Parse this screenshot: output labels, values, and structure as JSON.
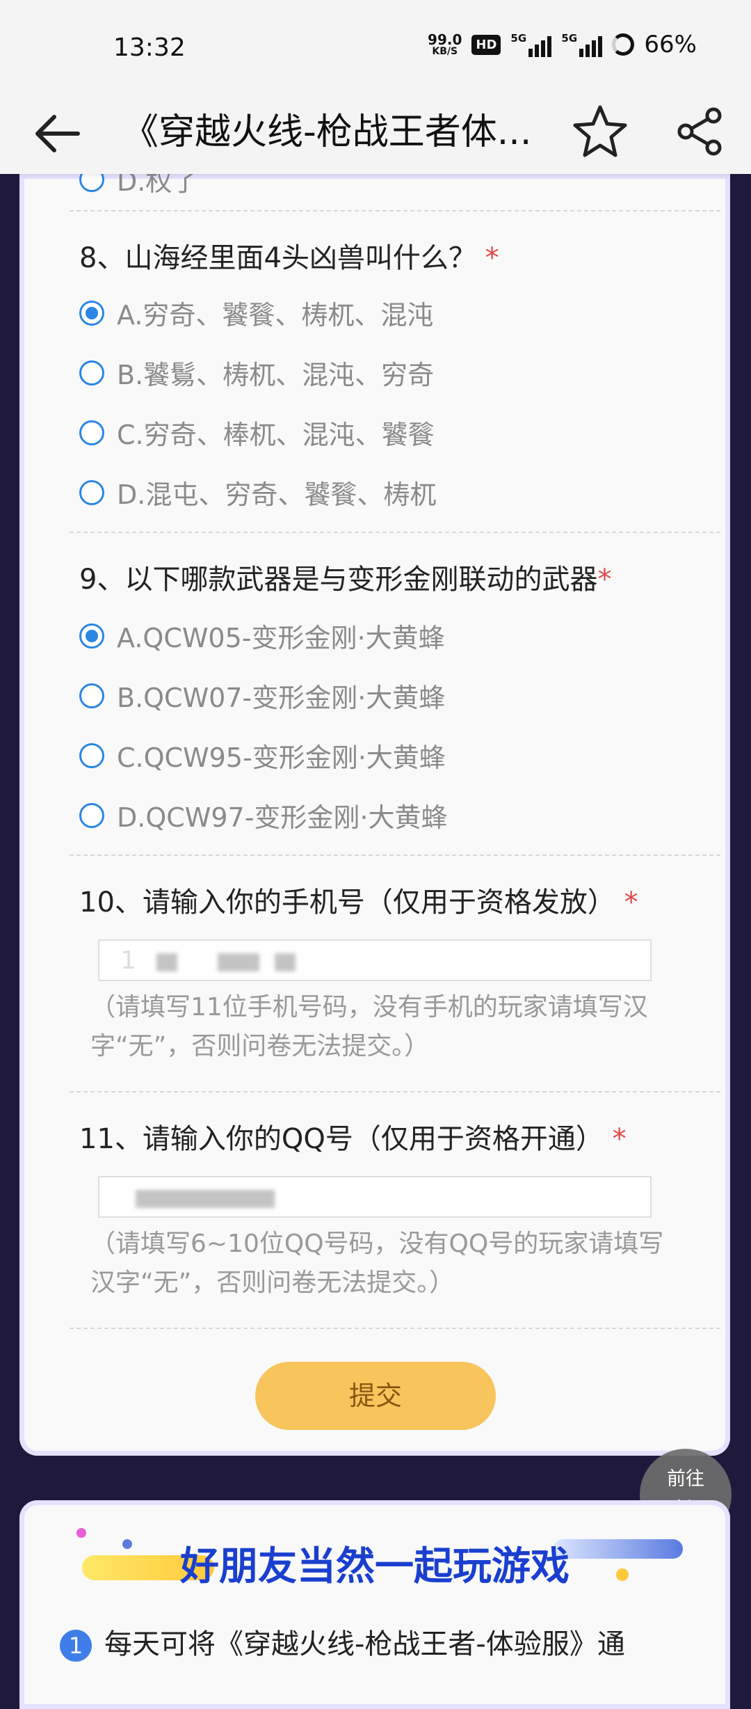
{
  "status_bar": {
    "time": "13:32",
    "net_speed_value": "99.0",
    "net_speed_unit": "KB/S",
    "hd_badge": "HD",
    "signal1_label": "5G",
    "signal2_label": "5G",
    "battery": "66%"
  },
  "app_bar": {
    "title": "《穿越火线-枪战王者体...",
    "back_icon": "arrow-left-icon",
    "star_icon": "star-icon",
    "share_icon": "share-icon"
  },
  "survey": {
    "prev_option_partial": "D.权了",
    "questions": [
      {
        "title": "8、山海经里面4头凶兽叫什么？",
        "required": "*",
        "options": [
          {
            "label": "A.穷奇、饕餮、梼杌、混沌",
            "checked": true
          },
          {
            "label": "B.饕鬄、梼杌、混沌、穷奇",
            "checked": false
          },
          {
            "label": "C.穷奇、棒杌、混沌、饕餮",
            "checked": false
          },
          {
            "label": "D.混屯、穷奇、饕餮、梼杌",
            "checked": false
          }
        ]
      },
      {
        "title": "9、以下哪款武器是与变形金刚联动的武器",
        "required": "*",
        "options": [
          {
            "label": "A.QCW05-变形金刚·大黄蜂",
            "checked": true
          },
          {
            "label": "B.QCW07-变形金刚·大黄蜂",
            "checked": false
          },
          {
            "label": "C.QCW95-变形金刚·大黄蜂",
            "checked": false
          },
          {
            "label": "D.QCW97-变形金刚·大黄蜂",
            "checked": false
          }
        ]
      }
    ],
    "phone": {
      "title": "10、请输入你的手机号（仅用于资格发放）",
      "required": "*",
      "value_visible": "1",
      "hint": "（请填写11位手机号码，没有手机的玩家请填写汉字“无”，否则问卷无法提交。）"
    },
    "qq": {
      "title": "11、请输入你的QQ号（仅用于资格开通）",
      "required": "*",
      "hint": "（请填写6~10位QQ号码，没有QQ号的玩家请填写汉字“无”，否则问卷无法提交。）"
    },
    "submit_label": "提交"
  },
  "forum_button": {
    "line1": "前往",
    "line2": "论坛"
  },
  "promo": {
    "title": "好朋友当然一起玩游戏",
    "item_number": "1",
    "item_text": "每天可将《穿越火线-枪战王者-体验服》通"
  },
  "colors": {
    "accent_blue": "#2b86e4",
    "required_red": "#e2474a",
    "submit_yellow": "#f8c45c",
    "page_bg": "#1f1a3c"
  }
}
